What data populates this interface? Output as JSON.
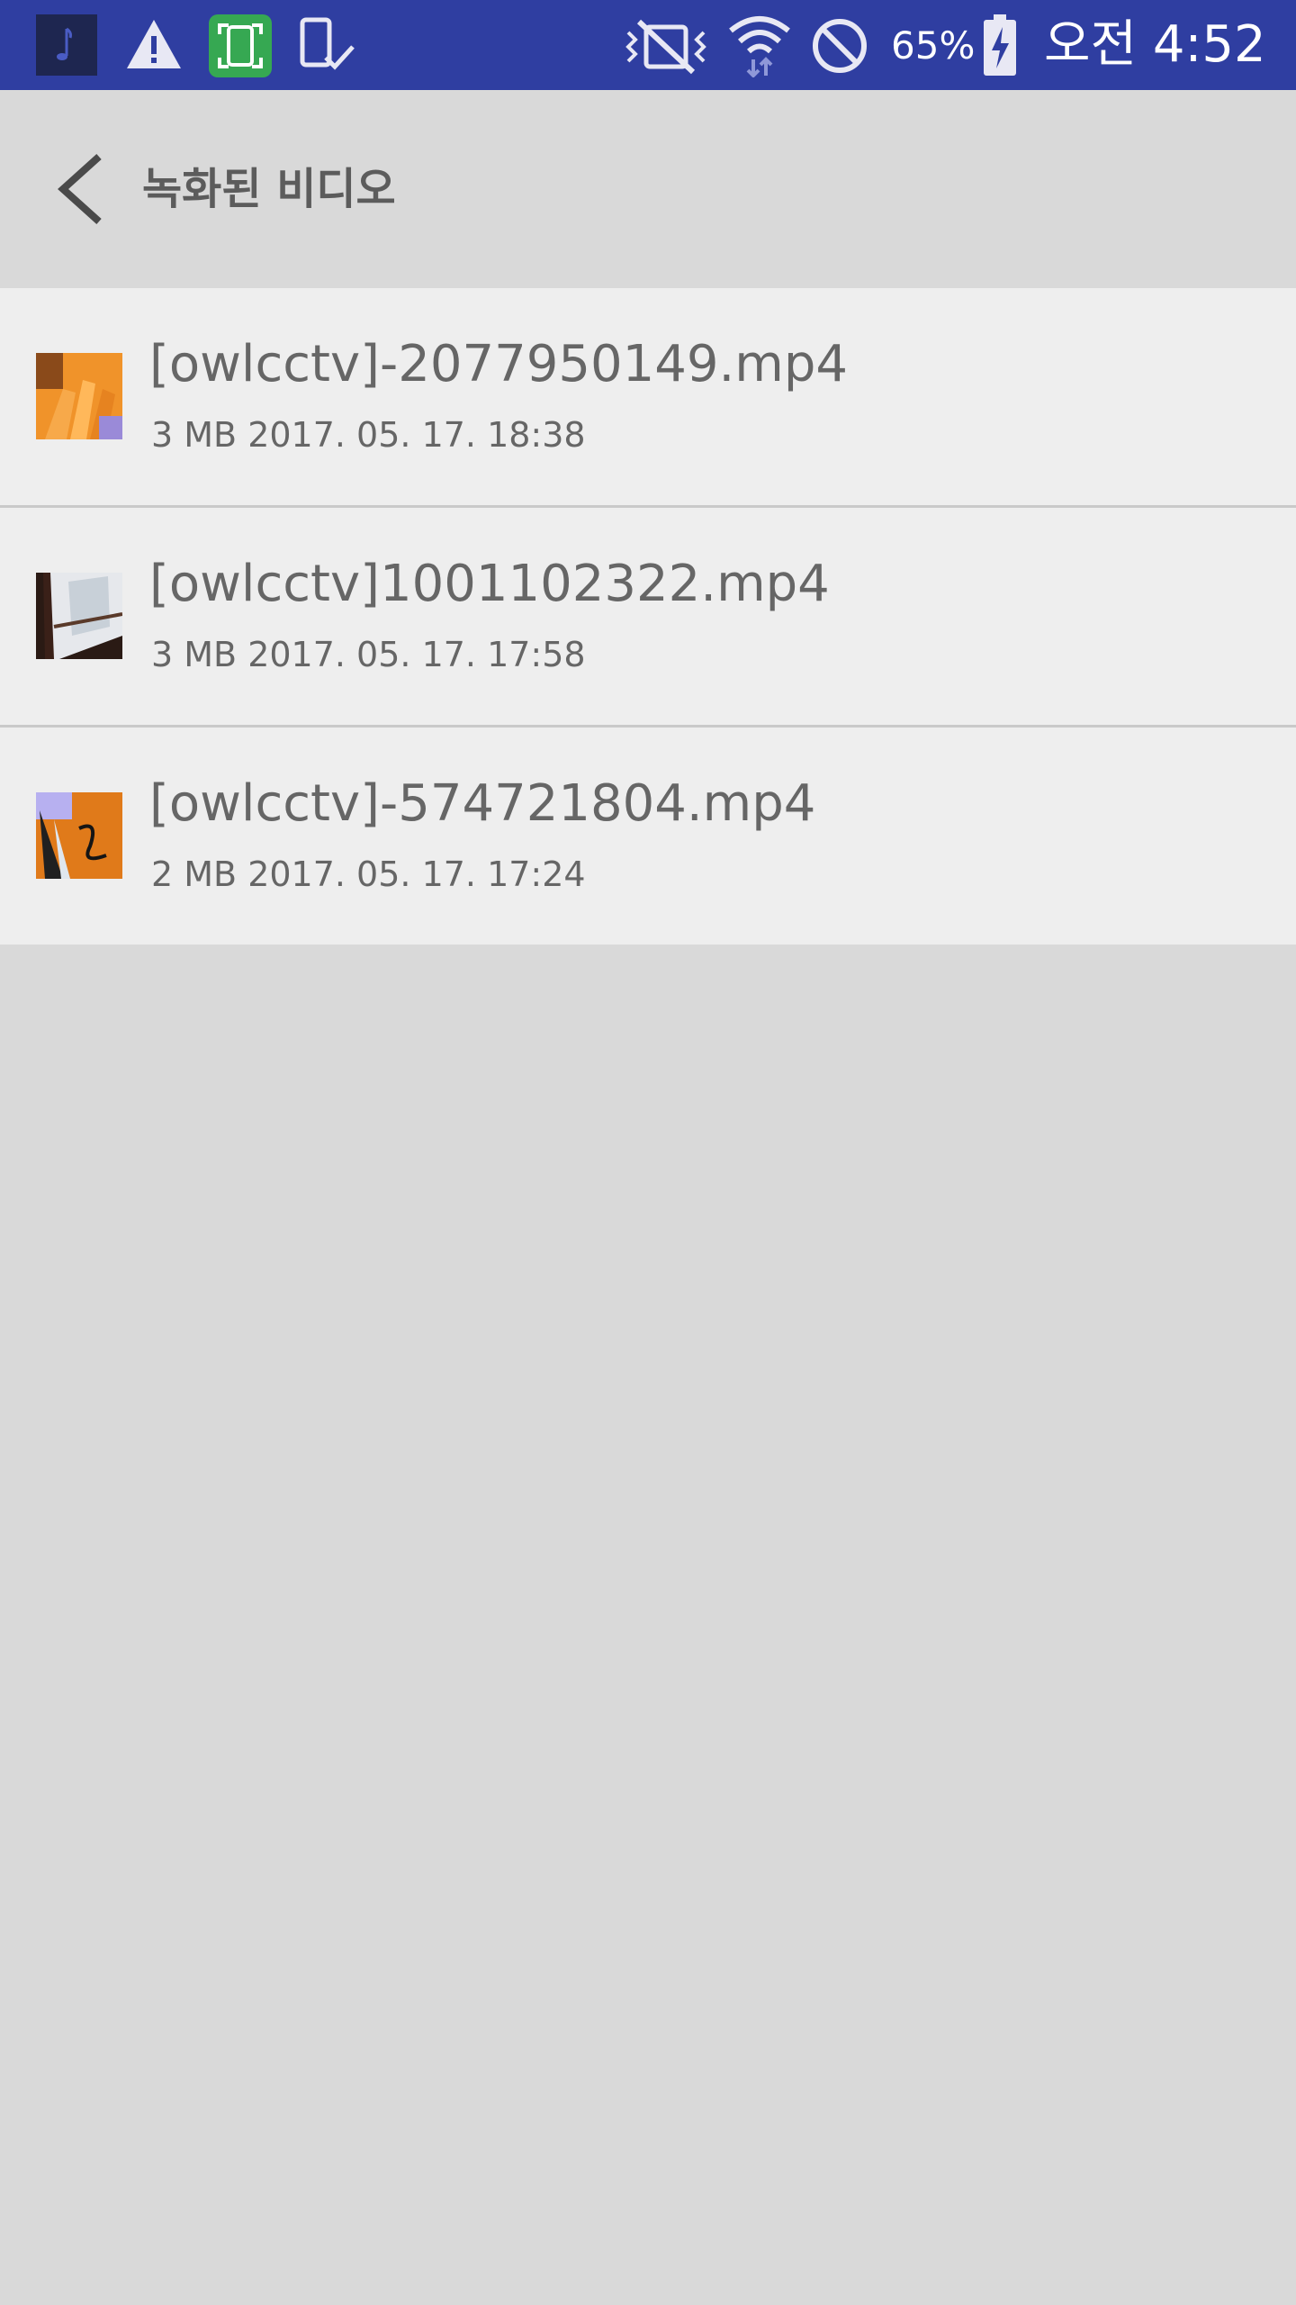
{
  "status_bar": {
    "left_icons": [
      "music-app-icon",
      "warning-icon",
      "screen-capture-icon",
      "device-check-icon"
    ],
    "right_icons": [
      "vibrate-mute-icon",
      "wifi-icon",
      "do-not-disturb-icon",
      "battery-charging-icon"
    ],
    "battery_percent": "65%",
    "time": "오전 4:52",
    "bg_color": "#2f3ea1"
  },
  "header": {
    "back_icon": "chevron-left-icon",
    "title": "녹화된 비디오"
  },
  "files": [
    {
      "name": "[owlcctv]-2077950149.mp4",
      "meta": "3 MB 2017. 05. 17. 18:38",
      "thumbnail": "orange-hand-thumbnail"
    },
    {
      "name": "[owlcctv]1001102322.mp4",
      "meta": "3 MB 2017. 05. 17. 17:58",
      "thumbnail": "window-thumbnail"
    },
    {
      "name": "[owlcctv]-574721804.mp4",
      "meta": "2 MB 2017. 05. 17. 17:24",
      "thumbnail": "cable-window-thumbnail"
    }
  ],
  "colors": {
    "list_row_bg": "#eeeeee",
    "page_bg": "#d9d9d9",
    "text_gray": "#666666"
  }
}
